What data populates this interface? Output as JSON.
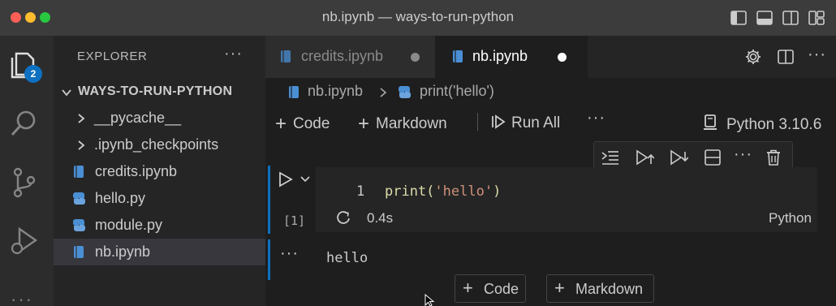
{
  "window": {
    "title": "nb.ipynb — ways-to-run-python",
    "traffic_lights": [
      "#ff5f57",
      "#febc2e",
      "#28c840"
    ]
  },
  "activity_bar": {
    "items": [
      "explorer-icon",
      "search-icon",
      "source-control-icon",
      "run-debug-icon",
      "more-icon"
    ],
    "explorer_badge": "2"
  },
  "sidebar": {
    "title": "EXPLORER",
    "more": "···",
    "folder": "WAYS-TO-RUN-PYTHON",
    "items": [
      {
        "label": "__pycache__",
        "type": "folder"
      },
      {
        "label": ".ipynb_checkpoints",
        "type": "folder"
      },
      {
        "label": "credits.ipynb",
        "type": "notebook"
      },
      {
        "label": "hello.py",
        "type": "python"
      },
      {
        "label": "module.py",
        "type": "python"
      },
      {
        "label": "nb.ipynb",
        "type": "notebook",
        "selected": true
      }
    ]
  },
  "tabs": [
    {
      "label": "credits.ipynb",
      "active": false,
      "modified": true
    },
    {
      "label": "nb.ipynb",
      "active": true,
      "modified": true
    }
  ],
  "breadcrumb": {
    "file": "nb.ipynb",
    "symbol": "print('hello')"
  },
  "notebook_toolbar": {
    "add_code": "Code",
    "add_markdown": "Markdown",
    "run_all": "Run All",
    "more": "···",
    "kernel": "Python 3.10.6"
  },
  "cell": {
    "line_number": "1",
    "code_func": "print(",
    "code_string": "'hello'",
    "code_close": ")",
    "exec_count": "[1]",
    "duration": "0.4s",
    "language": "Python",
    "output_more": "···",
    "output": "hello"
  },
  "add_cell": {
    "code": "Code",
    "markdown": "Markdown"
  },
  "colors": {
    "accent": "#0e70c0",
    "python_icon": "#4a8fd4",
    "string": "#ce9178",
    "function": "#dcdcaa"
  }
}
